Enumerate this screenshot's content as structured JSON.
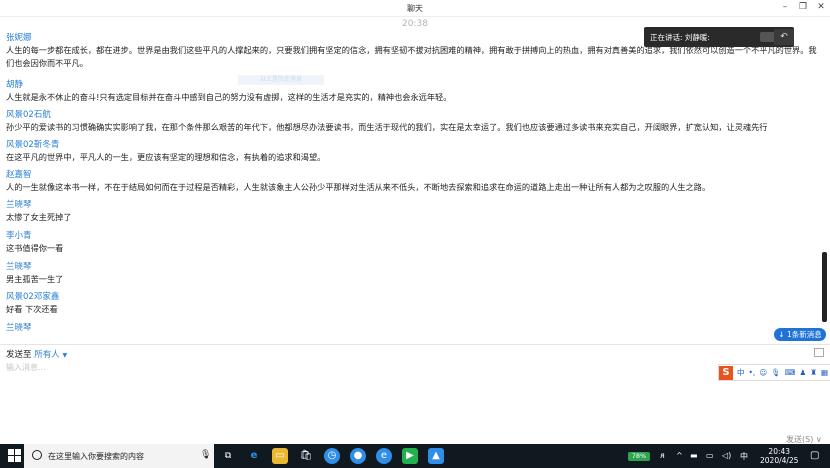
{
  "window": {
    "title": "聊天"
  },
  "chat": {
    "timestamp": "20:38",
    "ghost_text": "以上是历史消息",
    "messages": [
      {
        "sender": "张妮娜",
        "text": "人生的每一步都在成长，都在进步。世界是由我们这些平凡的人撑起来的，只要我们拥有坚定的信念，拥有坚韧不拔对抗困难的精神，拥有敢于拼搏向上的热血，拥有对真善美的追求，我们依然可以创造一个不平凡的世界。我们也会因你而不平凡。"
      },
      {
        "sender": "胡静",
        "text": "人生就是永不休止的奋斗!只有选定目标并在奋斗中感到自己的努力没有虚掷，这样的生活才是充实的，精神也会永远年轻。"
      },
      {
        "sender": "风景02石航",
        "text": "孙少平的爱读书的习惯确确实实影响了我，在那个条件那么艰苦的年代下，他都想尽办法要读书，而生活于现代的我们，实在是太幸运了。我们也应该要通过多读书来充实自己，开阔眼界，扩宽认知，让灵魂先行"
      },
      {
        "sender": "风景02靳冬青",
        "text": "在这平凡的世界中，平凡人的一生，更应该有坚定的理想和信念，有执着的追求和渴望。"
      },
      {
        "sender": "赵嘉智",
        "text": "人的一生就像这本书一样，不在于结局如何而在于过程是否精彩，人生就该象主人公孙少平那样对生活从来不低头，不断地去探索和追求在命运的道路上走出一种让所有人都为之叹服的人生之路。"
      },
      {
        "sender": "兰晓琴",
        "text": "太惨了女主死掉了"
      },
      {
        "sender": "李小青",
        "text": "这书值得你一看"
      },
      {
        "sender": "兰晓琴",
        "text": "男主孤苦一生了"
      },
      {
        "sender": "风景02邓家鑫",
        "text": "好看 下次还看"
      },
      {
        "sender": "兰晓琴",
        "text": ""
      }
    ],
    "new_message_badge": "1条新消息"
  },
  "speaker_popup": {
    "text": "正在讲话: 刘静暖:"
  },
  "composer": {
    "send_to_label": "发送至",
    "send_to_target": "所有人",
    "placeholder": "输入消息...",
    "send_button": "发送(S)"
  },
  "ime": {
    "mode": "中"
  },
  "taskbar": {
    "search_placeholder": "在这里输入你要搜索的内容",
    "battery": "78%",
    "ime_lang": "中",
    "time": "20:43",
    "date": "2020/4/25"
  },
  "colors": {
    "sender": "#2a7fd4",
    "badge": "#1f73d6",
    "taskbar": "#101820"
  }
}
